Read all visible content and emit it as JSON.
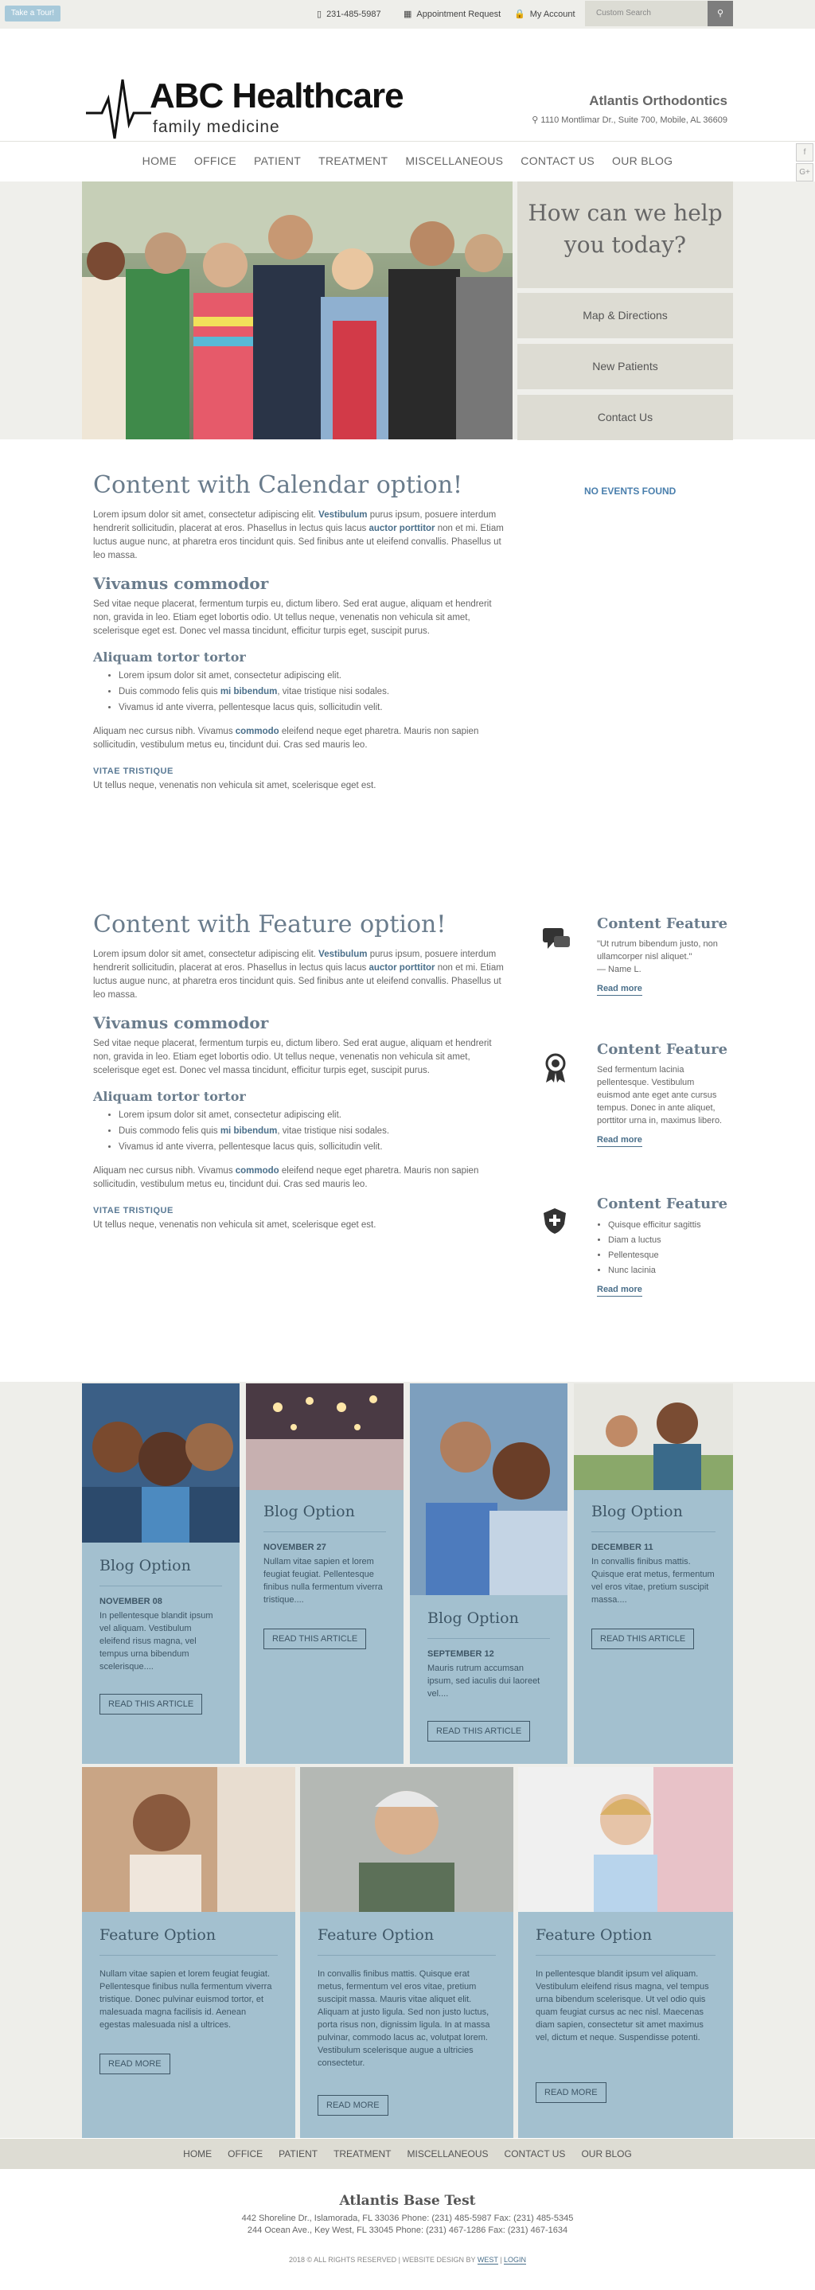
{
  "topbar": {
    "tour_label": "Take a Tour!",
    "phone": "231-485-5987",
    "appointment": "Appointment Request",
    "account": "My Account",
    "search_placeholder": "Custom Search"
  },
  "header": {
    "logo_name": "ABC Healthcare",
    "logo_sub": "family medicine",
    "practice": "Atlantis Orthodontics",
    "address": "1110 Montlimar Dr., Suite 700, Mobile, AL 36609"
  },
  "nav": [
    "HOME",
    "OFFICE",
    "PATIENT",
    "TREATMENT",
    "MISCELLANEOUS",
    "CONTACT US",
    "OUR BLOG"
  ],
  "social_icons": [
    "facebook-icon",
    "google-plus-icon",
    "instagram-icon",
    "linkedin-icon",
    "twitter-icon",
    "pinterest-icon",
    "youtube-icon",
    "rss-icon",
    "blog-icon",
    "yelp-icon",
    "chat-icon"
  ],
  "hero": {
    "help_title": "How can we help you today?",
    "buttons": [
      "Map & Directions",
      "New Patients",
      "Contact Us"
    ]
  },
  "calendar_section": {
    "title": "Content with Calendar option!",
    "p1_a": "Lorem ipsum dolor sit amet, consectetur adipiscing elit. ",
    "p1_b": "Vestibulum",
    "p1_c": " purus ipsum, posuere interdum hendrerit sollicitudin, placerat at eros. Phasellus in lectus quis lacus ",
    "p1_d": "auctor porttitor",
    "p1_e": " non et mi. Etiam luctus augue nunc, at pharetra eros tincidunt quis. Sed finibus ante ut eleifend convallis. Phasellus ut leo massa.",
    "h2": "Vivamus commodor",
    "p2": "Sed vitae neque placerat, fermentum turpis eu, dictum libero. Sed erat augue, aliquam et hendrerit non, gravida in leo. Etiam eget lobortis odio. Ut tellus neque, venenatis non vehicula sit amet, scelerisque eget est. Donec vel massa tincidunt, efficitur turpis eget, suscipit purus.",
    "h3": "Aliquam tortor tortor",
    "li1": "Lorem ipsum dolor sit amet, consectetur adipiscing elit.",
    "li2_a": "Duis commodo felis quis ",
    "li2_b": "mi bibendum",
    "li2_c": ", vitae tristique nisi sodales.",
    "li3": "Vivamus id ante viverra, pellentesque lacus quis, sollicitudin velit.",
    "p3_a": "Aliquam nec cursus nibh. Vivamus ",
    "p3_b": "commodo",
    "p3_c": " eleifend neque eget pharetra. Mauris non sapien sollicitudin, vestibulum metus eu, tincidunt dui. Cras sed mauris leo.",
    "h4": "VITAE TRISTIQUE",
    "p4": "Ut tellus neque, venenatis non vehicula sit amet, scelerisque eget est.",
    "events": "NO EVENTS FOUND"
  },
  "feature_section": {
    "title": "Content with Feature option!",
    "features": [
      {
        "title": "Content Feature",
        "text": "\"Ut rutrum bibendum justo, non ullamcorper nisl aliquet.\"",
        "name": "— Name L.",
        "more": "Read more"
      },
      {
        "title": "Content Feature",
        "text": "Sed fermentum lacinia pellentesque. Vestibulum euismod ante eget ante cursus tempus. Donec in ante aliquet, porttitor urna in, maximus libero.",
        "more": "Read more"
      },
      {
        "title": "Content Feature",
        "items": [
          "Quisque efficitur sagittis",
          "Diam a luctus",
          "Pellentesque",
          "Nunc lacinia"
        ],
        "more": "Read more"
      }
    ]
  },
  "blog_cards": [
    {
      "title": "Blog Option",
      "date": "NOVEMBER 08",
      "text": "In pellentesque blandit ipsum vel aliquam. Vestibulum eleifend risus magna, vel tempus urna bibendum scelerisque....",
      "button": "READ THIS ARTICLE"
    },
    {
      "title": "Blog Option",
      "date": "NOVEMBER 27",
      "text": "Nullam vitae sapien et lorem feugiat feugiat. Pellentesque finibus nulla fermentum viverra tristique....",
      "button": "READ THIS ARTICLE"
    },
    {
      "title": "Blog Option",
      "date": "SEPTEMBER 12",
      "text": "Mauris rutrum accumsan ipsum, sed iaculis dui laoreet vel....",
      "button": "READ THIS ARTICLE"
    },
    {
      "title": "Blog Option",
      "date": "DECEMBER 11",
      "text": "In convallis finibus mattis. Quisque erat metus, fermentum vel eros vitae, pretium suscipit massa....",
      "button": "READ THIS ARTICLE"
    }
  ],
  "feature_cards": [
    {
      "title": "Feature Option",
      "text": "Nullam vitae sapien et lorem feugiat feugiat. Pellentesque finibus nulla fermentum viverra tristique. Donec pulvinar euismod tortor, et malesuada magna facilisis id. Aenean egestas malesuada nisl a ultrices.",
      "button": "READ MORE"
    },
    {
      "title": "Feature Option",
      "text": "In convallis finibus mattis. Quisque erat metus, fermentum vel eros vitae, pretium suscipit massa. Mauris vitae aliquet elit. Aliquam at justo ligula. Sed non justo luctus, porta risus non, dignissim ligula. In at massa pulvinar, commodo lacus ac, volutpat lorem. Vestibulum scelerisque augue a ultricies consectetur.",
      "button": "READ MORE"
    },
    {
      "title": "Feature Option",
      "text": "In pellentesque blandit ipsum vel aliquam. Vestibulum eleifend risus magna, vel tempus urna bibendum scelerisque. Ut vel odio quis quam feugiat cursus ac nec nisl. Maecenas diam sapien, consectetur sit amet maximus vel, dictum et neque. Suspendisse potenti.",
      "button": "READ MORE"
    }
  ],
  "footer": {
    "nav": [
      "HOME",
      "OFFICE",
      "PATIENT",
      "TREATMENT",
      "MISCELLANEOUS",
      "CONTACT US",
      "OUR BLOG"
    ],
    "name": "Atlantis Base Test",
    "line1": "442 Shoreline Dr., Islamorada, FL 33036  Phone: (231) 485-5987  Fax: (231) 485-5345",
    "line2": "244 Ocean Ave., Key West, FL 33045  Phone: (231) 467-1286  Fax: (231) 467-1634",
    "copyright": "2018 © ALL RIGHTS RESERVED | WEBSITE DESIGN BY",
    "design_link": "WEST",
    "login": "LOGIN"
  },
  "colors": {
    "accent": "#a3c0cf",
    "heading": "#6a7c8c",
    "link": "#4a6f8a",
    "beige": "#dddcd3"
  }
}
